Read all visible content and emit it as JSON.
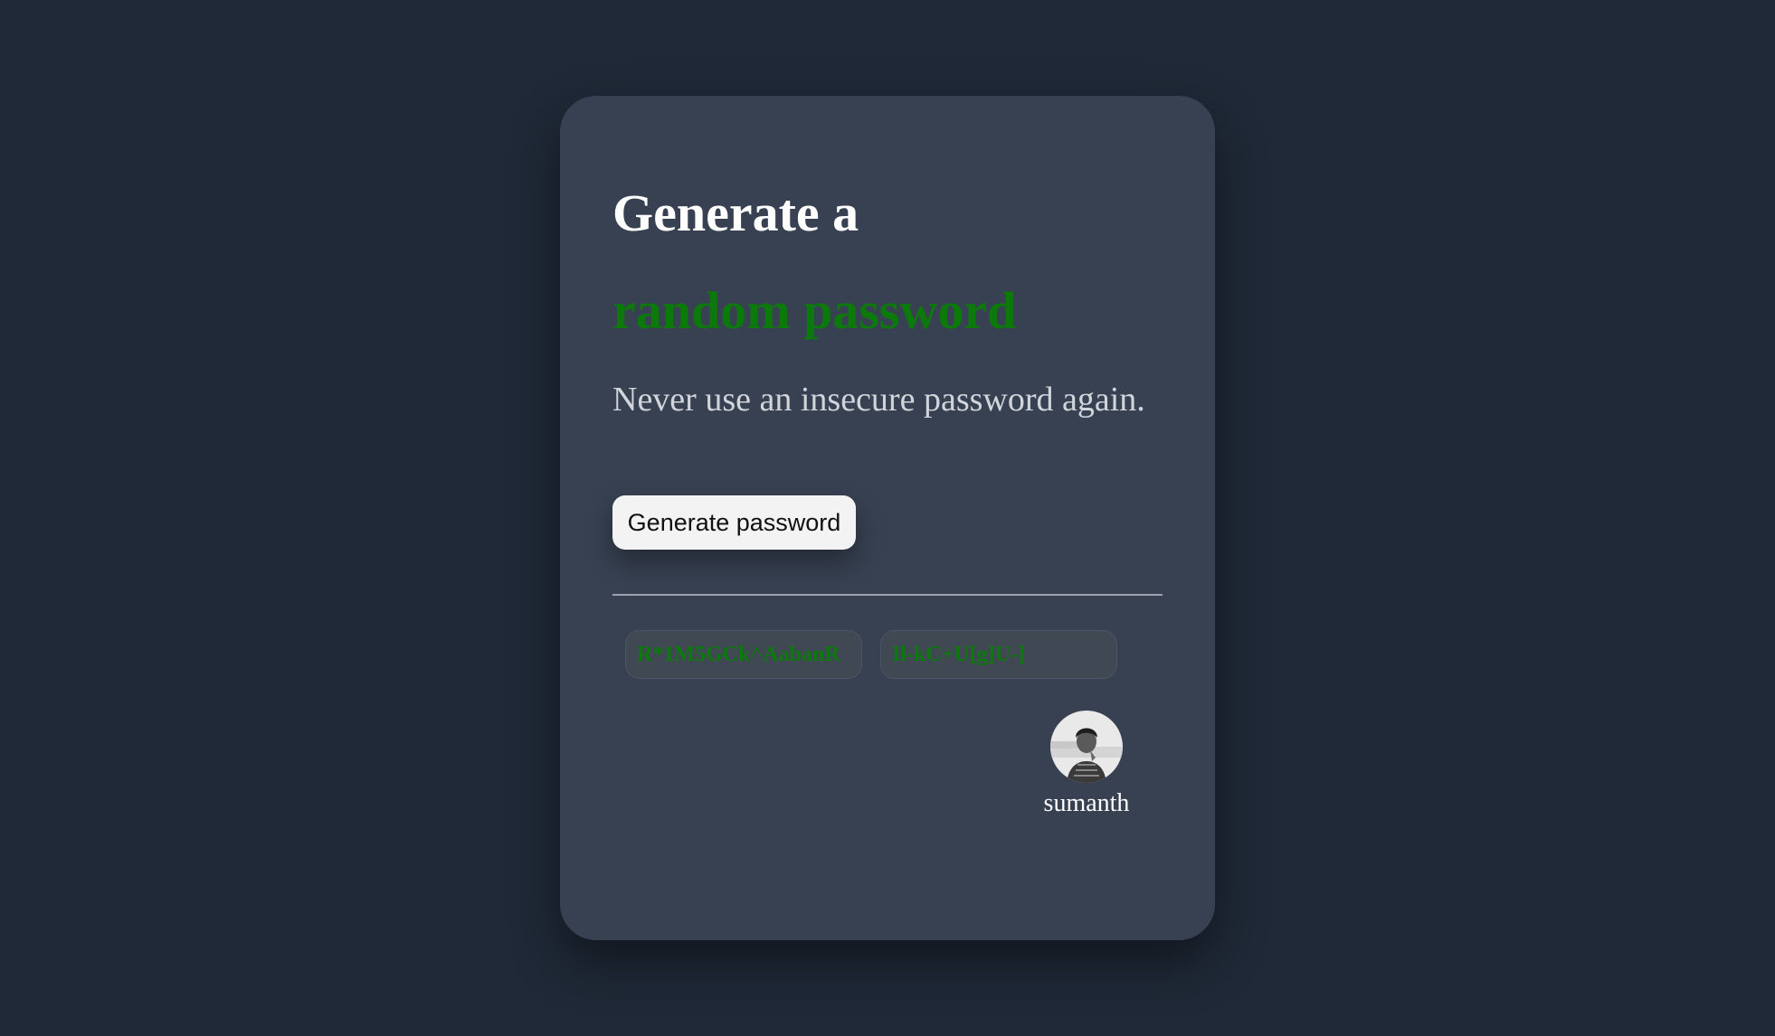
{
  "header": {
    "title_line1": "Generate a",
    "title_line2": "random password",
    "subtitle": "Never use an insecure password again."
  },
  "actions": {
    "generate_label": "Generate password"
  },
  "passwords": [
    "R*1M5GCk^AabanR",
    "Il-kC+U[g]U-]"
  ],
  "author": {
    "name": "sumanth"
  },
  "colors": {
    "background": "#1f2937",
    "card": "#374151",
    "accent_green": "#0b7a0b",
    "text_white": "#ffffff",
    "text_muted": "#d1d5db"
  }
}
